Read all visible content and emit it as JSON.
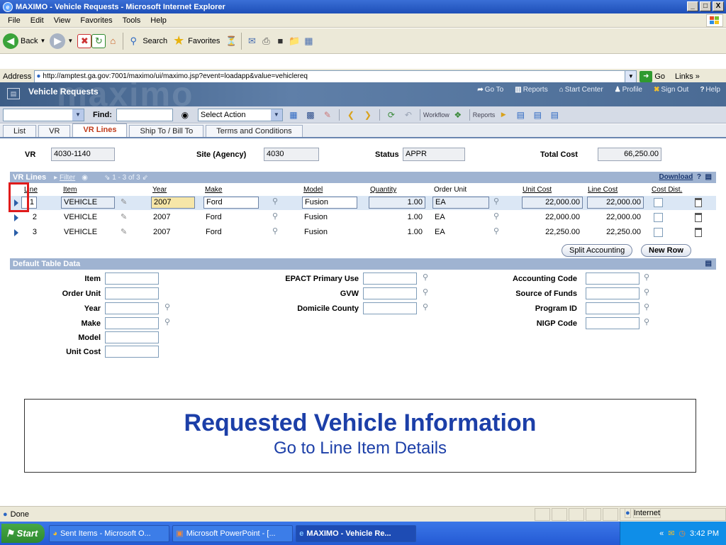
{
  "window": {
    "title": "MAXIMO - Vehicle Requests - Microsoft Internet Explorer",
    "controls": [
      "_",
      "□",
      "X"
    ]
  },
  "menu": [
    "File",
    "Edit",
    "View",
    "Favorites",
    "Tools",
    "Help"
  ],
  "toolbar": {
    "back": "Back",
    "search": "Search",
    "favorites": "Favorites"
  },
  "address": {
    "label": "Address",
    "url": "http://amptest.ga.gov:7001/maximo/ui/maximo.jsp?event=loadapp&value=vehiclereq",
    "go": "Go",
    "links": "Links"
  },
  "app": {
    "title": "Vehicle Requests",
    "logo_bg": "maximo",
    "links": [
      {
        "icon": "goto-icon",
        "label": "Go To"
      },
      {
        "icon": "reports-icon",
        "label": "Reports"
      },
      {
        "icon": "start-center-icon",
        "label": "Start Center"
      },
      {
        "icon": "profile-icon",
        "label": "Profile"
      },
      {
        "icon": "signout-icon",
        "label": "Sign Out"
      },
      {
        "icon": "help-icon",
        "label": "Help"
      }
    ]
  },
  "mx_toolbar": {
    "find_label": "Find:",
    "select_action": "Select Action",
    "workflow": "Workflow",
    "reports": "Reports"
  },
  "tabs": [
    "List",
    "VR",
    "VR Lines",
    "Ship To / Bill To",
    "Terms and Conditions"
  ],
  "header": {
    "vr_label": "VR",
    "vr_value": "4030-1140",
    "site_label": "Site (Agency)",
    "site_value": "4030",
    "status_label": "Status",
    "status_value": "APPR",
    "total_label": "Total Cost",
    "total_value": "66,250.00"
  },
  "vrlines": {
    "title": "VR Lines",
    "filter": "Filter",
    "range": "1 - 3 of 3",
    "download": "Download",
    "columns": [
      "Line",
      "Item",
      "Year",
      "Make",
      "Model",
      "Quantity",
      "Order Unit",
      "Unit Cost",
      "Line Cost",
      "Cost Dist."
    ],
    "rows": [
      {
        "line": "1",
        "item": "VEHICLE",
        "year": "2007",
        "make": "Ford",
        "model": "Fusion",
        "qty": "1.00",
        "unit": "EA",
        "unit_cost": "22,000.00",
        "line_cost": "22,000.00"
      },
      {
        "line": "2",
        "item": "VEHICLE",
        "year": "2007",
        "make": "Ford",
        "model": "Fusion",
        "qty": "1.00",
        "unit": "EA",
        "unit_cost": "22,000.00",
        "line_cost": "22,000.00"
      },
      {
        "line": "3",
        "item": "VEHICLE",
        "year": "2007",
        "make": "Ford",
        "model": "Fusion",
        "qty": "1.00",
        "unit": "EA",
        "unit_cost": "22,250.00",
        "line_cost": "22,250.00"
      }
    ],
    "split_btn": "Split Accounting",
    "new_row_btn": "New Row"
  },
  "default_table": {
    "title": "Default Table Data",
    "left": [
      "Item",
      "Order Unit",
      "Year",
      "Make",
      "Model",
      "Unit Cost"
    ],
    "middle": [
      "EPACT Primary Use",
      "GVW",
      "Domicile County"
    ],
    "right": [
      "Accounting Code",
      "Source of Funds",
      "Program ID",
      "NIGP Code"
    ]
  },
  "caption": {
    "title": "Requested Vehicle Information",
    "subtitle": "Go to Line Item Details"
  },
  "status": {
    "text": "Done",
    "zone": "Internet"
  },
  "taskbar": {
    "start": "Start",
    "tasks": [
      "Sent Items - Microsoft O...",
      "Microsoft PowerPoint - [...",
      "MAXIMO - Vehicle Re..."
    ],
    "time": "3:42 PM"
  },
  "colors": {
    "accent": "#1c3fa8",
    "highlight": "#e01b1b",
    "section": "#9fb3d1"
  }
}
